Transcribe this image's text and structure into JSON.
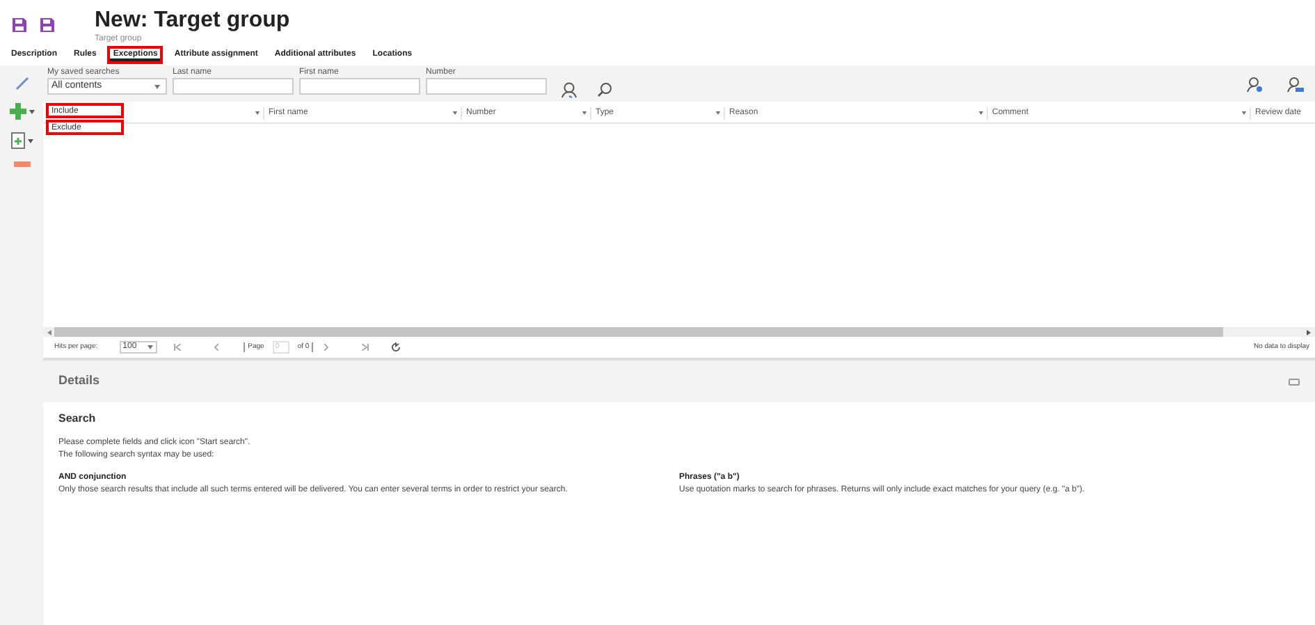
{
  "header": {
    "title": "New: Target group",
    "subtitle": "Target group"
  },
  "tabs": [
    {
      "label": "Description",
      "selected": false,
      "highlighted": false
    },
    {
      "label": "Rules",
      "selected": false,
      "highlighted": false
    },
    {
      "label": "Exceptions",
      "selected": true,
      "highlighted": true
    },
    {
      "label": "Attribute assignment",
      "selected": false,
      "highlighted": false
    },
    {
      "label": "Additional attributes",
      "selected": false,
      "highlighted": false
    },
    {
      "label": "Locations",
      "selected": false,
      "highlighted": false
    }
  ],
  "search_bar": {
    "saved_searches": {
      "label": "My saved searches",
      "value": "All contents"
    },
    "fields": [
      {
        "label": "Last name"
      },
      {
        "label": "First name"
      },
      {
        "label": "Number"
      }
    ]
  },
  "add_menu": [
    {
      "label": "Include",
      "highlighted": true
    },
    {
      "label": "Exclude",
      "highlighted": true
    }
  ],
  "table": {
    "columns": [
      {},
      {
        "label": "First name"
      },
      {
        "label": "Number"
      },
      {
        "label": "Type"
      },
      {
        "label": "Reason"
      },
      {
        "label": "Comment"
      },
      {
        "label": "Review date"
      }
    ]
  },
  "pager": {
    "hits_label": "Hits per page:",
    "hits_value": "100",
    "page_label": "Page",
    "page_value": "0",
    "of_label": "of 0",
    "status": "No data to display"
  },
  "details": {
    "title": "Details",
    "heading": "Search",
    "intro": [
      "Please complete fields and click icon \"Start search\".",
      "The following search syntax may be used:"
    ],
    "sections": [
      {
        "title": "AND conjunction",
        "text": "Only those search results that include all such terms entered will be delivered. You can enter several terms in order to restrict your search."
      },
      {
        "title": "Phrases (\"a b\")",
        "text": "Use quotation marks to search for phrases. Returns will only include exact matches for your query (e.g. \"a b\")."
      }
    ]
  }
}
